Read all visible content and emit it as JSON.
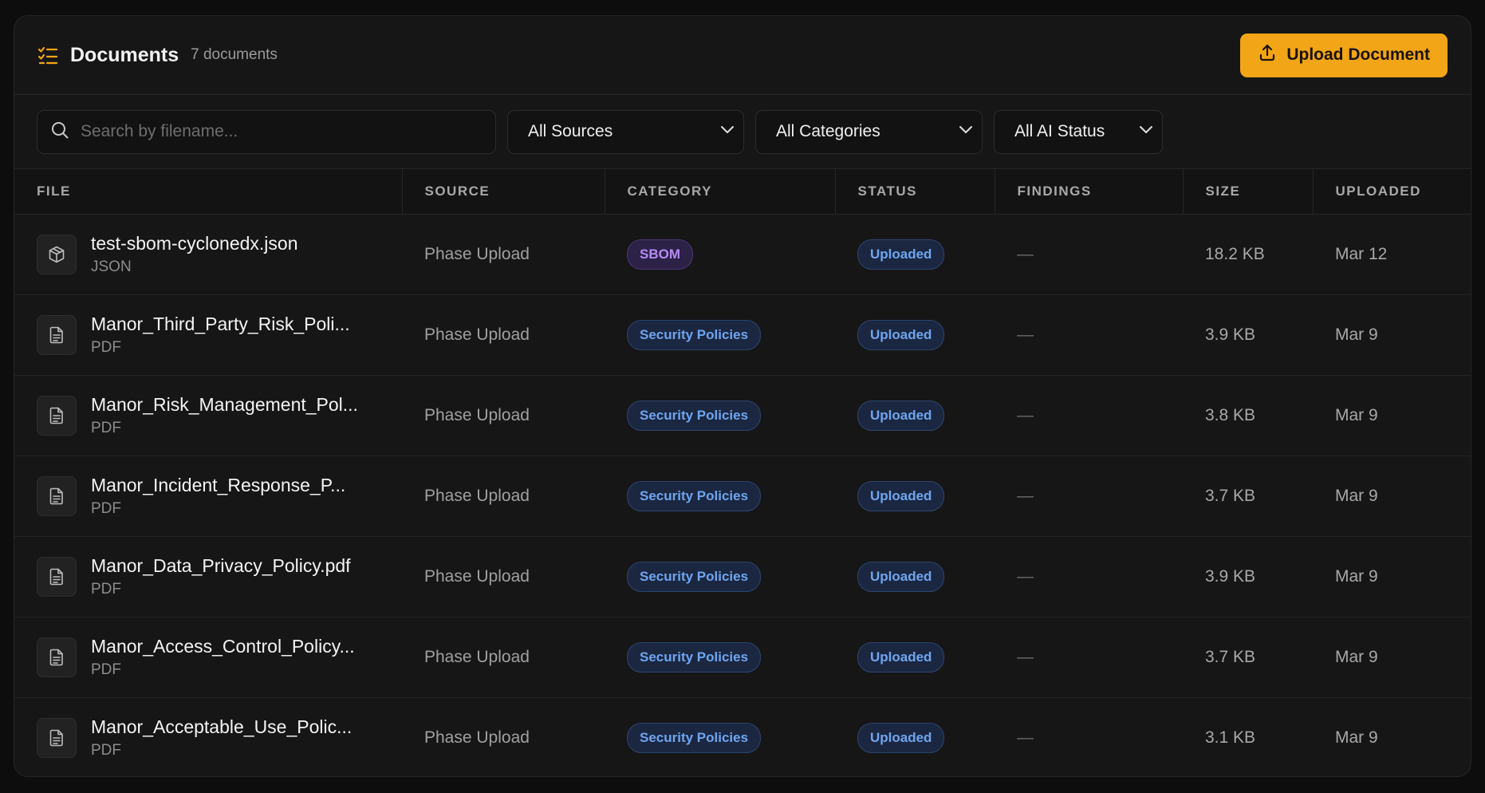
{
  "header": {
    "title": "Documents",
    "count": "7 documents",
    "upload_label": "Upload Document"
  },
  "toolbar": {
    "search_placeholder": "Search by filename...",
    "filters": [
      "All Sources",
      "All Categories",
      "All AI Status"
    ]
  },
  "table": {
    "columns": [
      "FILE",
      "SOURCE",
      "CATEGORY",
      "STATUS",
      "FINDINGS",
      "SIZE",
      "UPLOADED"
    ],
    "rows": [
      {
        "name": "test-sbom-cyclonedx.json",
        "type": "JSON",
        "icon": "package-icon",
        "source": "Phase Upload",
        "category": "SBOM",
        "status": "Uploaded",
        "findings": "—",
        "size": "18.2 KB",
        "uploaded": "Mar 12"
      },
      {
        "name": "Manor_Third_Party_Risk_Poli...",
        "type": "PDF",
        "icon": "document-icon",
        "source": "Phase Upload",
        "category": "Security Policies",
        "status": "Uploaded",
        "findings": "—",
        "size": "3.9 KB",
        "uploaded": "Mar 9"
      },
      {
        "name": "Manor_Risk_Management_Pol...",
        "type": "PDF",
        "icon": "document-icon",
        "source": "Phase Upload",
        "category": "Security Policies",
        "status": "Uploaded",
        "findings": "—",
        "size": "3.8 KB",
        "uploaded": "Mar 9"
      },
      {
        "name": "Manor_Incident_Response_P...",
        "type": "PDF",
        "icon": "document-icon",
        "source": "Phase Upload",
        "category": "Security Policies",
        "status": "Uploaded",
        "findings": "—",
        "size": "3.7 KB",
        "uploaded": "Mar 9"
      },
      {
        "name": "Manor_Data_Privacy_Policy.pdf",
        "type": "PDF",
        "icon": "document-icon",
        "source": "Phase Upload",
        "category": "Security Policies",
        "status": "Uploaded",
        "findings": "—",
        "size": "3.9 KB",
        "uploaded": "Mar 9"
      },
      {
        "name": "Manor_Access_Control_Policy...",
        "type": "PDF",
        "icon": "document-icon",
        "source": "Phase Upload",
        "category": "Security Policies",
        "status": "Uploaded",
        "findings": "—",
        "size": "3.7 KB",
        "uploaded": "Mar 9"
      },
      {
        "name": "Manor_Acceptable_Use_Polic...",
        "type": "PDF",
        "icon": "document-icon",
        "source": "Phase Upload",
        "category": "Security Policies",
        "status": "Uploaded",
        "findings": "—",
        "size": "3.1 KB",
        "uploaded": "Mar 9"
      }
    ]
  },
  "colors": {
    "accent": "#f2a516",
    "sbom_badge": "#b58cf5",
    "policy_badge": "#6fa5f0"
  }
}
